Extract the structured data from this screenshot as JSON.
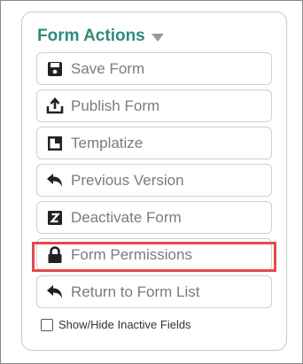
{
  "panel": {
    "title": "Form Actions",
    "title_color": "#2f8c7a",
    "caret_icon": "triangle-down-icon"
  },
  "buttons": [
    {
      "label": "Save Form",
      "icon": "save-icon"
    },
    {
      "label": "Publish Form",
      "icon": "publish-upload-icon"
    },
    {
      "label": "Templatize",
      "icon": "template-icon"
    },
    {
      "label": "Previous Version",
      "icon": "undo-arrow-icon"
    },
    {
      "label": "Deactivate Form",
      "icon": "z-box-icon"
    },
    {
      "label": "Form Permissions",
      "icon": "lock-icon",
      "highlighted": true
    },
    {
      "label": "Return to Form List",
      "icon": "return-arrow-icon"
    }
  ],
  "checkbox": {
    "label": "Show/Hide Inactive Fields",
    "checked": false
  },
  "colors": {
    "icon": "#222222",
    "label": "#7b7b7b",
    "highlight": "#e14b4f"
  }
}
